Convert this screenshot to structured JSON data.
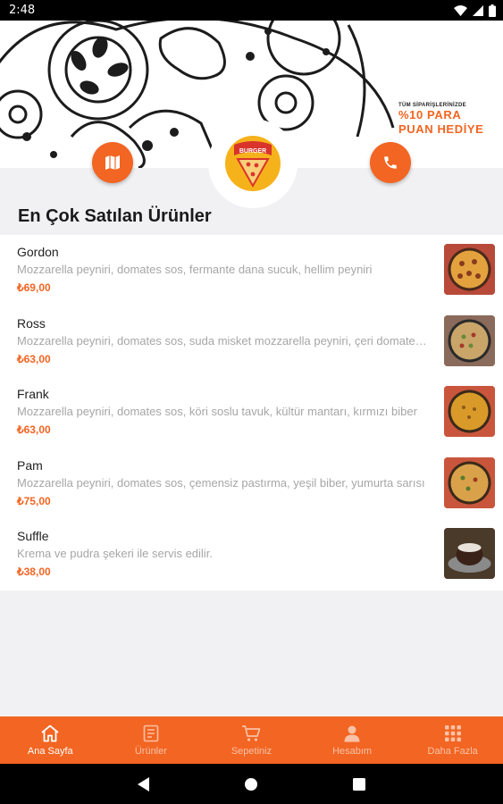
{
  "status_bar": {
    "time": "2:48"
  },
  "banner": {
    "promo_small": "TÜM SİPARİŞLERİNİZDE",
    "promo_line1": "%10 PARA",
    "promo_line2": "PUAN HEDİYE",
    "logo_text": "BURGER"
  },
  "section_title": "En Çok Satılan Ürünler",
  "products": [
    {
      "name": "Gordon",
      "description": "Mozzarella peyniri, domates sos, fermante dana sucuk, hellim peyniri",
      "price": "₺69,00"
    },
    {
      "name": "Ross",
      "description": "Mozzarella peyniri, domates sos, suda misket mozzarella peyniri, çeri domates, fesleğen",
      "price": "₺63,00"
    },
    {
      "name": "Frank",
      "description": "Mozzarella peyniri, domates sos, köri soslu tavuk, kültür mantarı, kırmızı biber",
      "price": "₺63,00"
    },
    {
      "name": "Pam",
      "description": "Mozzarella peyniri, domates sos, çemensiz pastırma, yeşil biber, yumurta sarısı",
      "price": "₺75,00"
    },
    {
      "name": "Suffle",
      "description": "Krema ve pudra şekeri ile servis edilir.",
      "price": "₺38,00"
    }
  ],
  "bottom_nav": [
    {
      "label": "Ana Sayfa",
      "icon": "home-icon",
      "active": true
    },
    {
      "label": "Ürünler",
      "icon": "menu-list-icon",
      "active": false
    },
    {
      "label": "Sepetiniz",
      "icon": "cart-icon",
      "active": false
    },
    {
      "label": "Hesabım",
      "icon": "person-icon",
      "active": false
    },
    {
      "label": "Daha Fazla",
      "icon": "grid-icon",
      "active": false
    }
  ],
  "colors": {
    "accent": "#f26522",
    "logo_yellow": "#f6b21b"
  }
}
